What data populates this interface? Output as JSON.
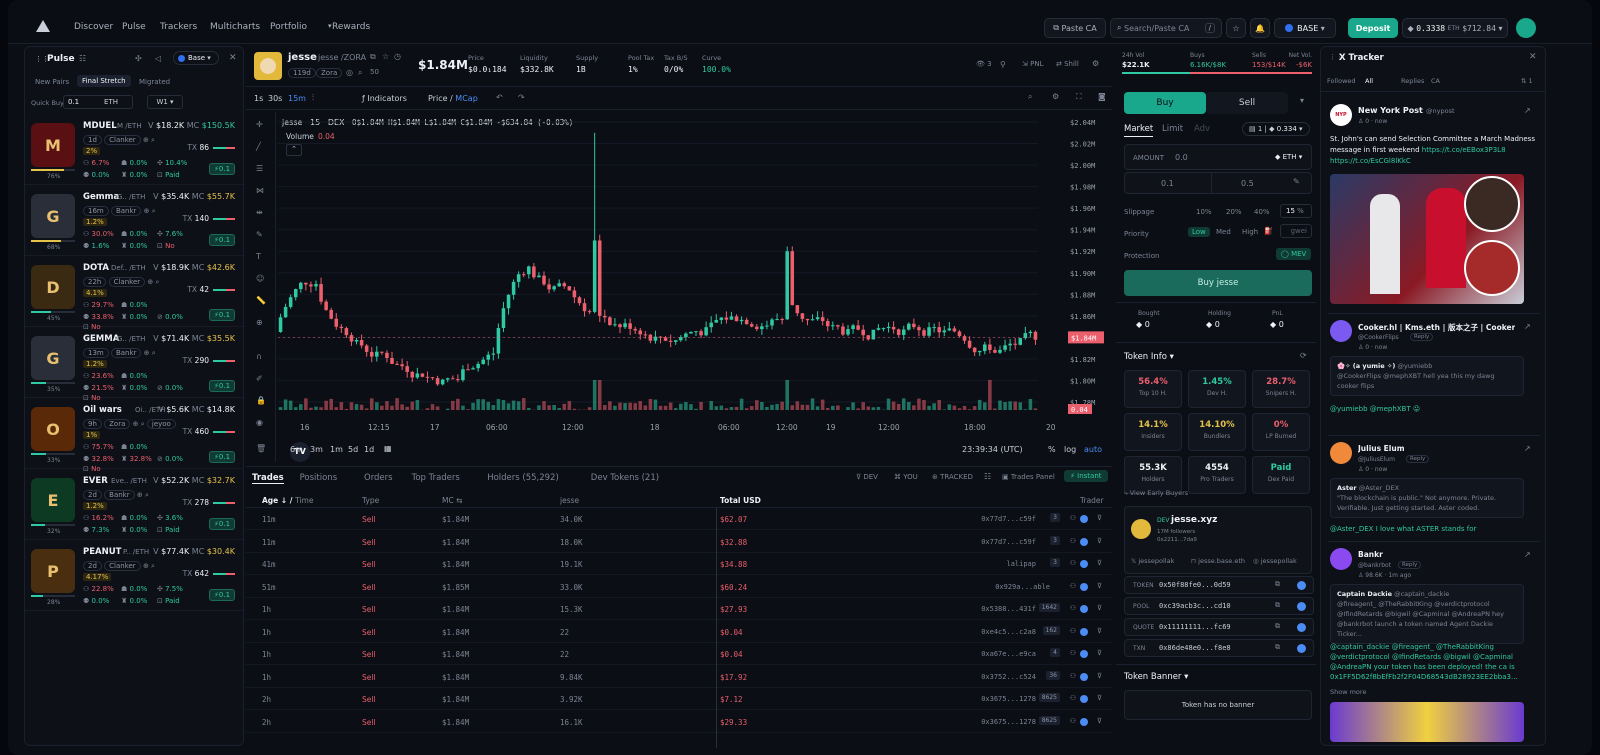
{
  "nav": {
    "items": [
      "Discover",
      "Pulse",
      "Trackers",
      "Multicharts",
      "Portfolio",
      "Rewards"
    ],
    "paste_ca": "Paste CA",
    "search_placeholder": "Search/Paste CA",
    "search_key": "/",
    "chain": "BASE",
    "deposit": "Deposit",
    "eth_balance": "0.3338",
    "eth_unit": "ETH",
    "usd_balance": "$712.84"
  },
  "pulse": {
    "title": "Pulse",
    "chain": "Base",
    "tabs": [
      "New Pairs",
      "Final Stretch",
      "Migrated"
    ],
    "quick_buy_label": "Quick Buy",
    "quick_buy_value": "0.1",
    "quick_buy_unit": "ETH",
    "preset": "W1",
    "tokens": [
      {
        "name": "MDUEL",
        "sub": "M",
        "chain": "/ETH",
        "v": "$18.2K",
        "mc": "$150.5K",
        "age": "1d",
        "launch": "Clanker",
        "tx": "86",
        "pct": "2%",
        "s1": "6.7%",
        "s2": "0.0%",
        "s3": "10.4%",
        "s4": "0.0%",
        "s5": "0.0%",
        "paid": "Paid",
        "progress": "76%",
        "qb": "0.1",
        "mccolor": "#2fc9a3",
        "bg": "#5a0f12",
        "initial": "M"
      },
      {
        "name": "Gemma",
        "sub": "G..",
        "chain": "/ETH",
        "v": "$35.4K",
        "mc": "$55.7K",
        "age": "16m",
        "launch": "Bankr",
        "tx": "140",
        "pct": "1.2%",
        "s1": "30.0%",
        "s2": "0.0%",
        "s3": "7.6%",
        "s4": "1.6%",
        "s5": "0.0%",
        "paid": "No",
        "progress": "68%",
        "qb": "0.1",
        "mccolor": "#e6c24a",
        "bg": "#2a2e38",
        "initial": "G"
      },
      {
        "name": "DOTA",
        "sub": "Def..",
        "chain": "/ETH",
        "v": "$18.9K",
        "mc": "$42.6K",
        "age": "22h",
        "launch": "Clanker",
        "tx": "42",
        "pct": "4.1%",
        "s1": "29.7%",
        "s2": "0.0%",
        "s3": "",
        "s4": "33.8%",
        "s5": "0.0%",
        "s6": "0.0%",
        "paid": "No",
        "progress": "45%",
        "qb": "0.1",
        "mccolor": "#e6c24a",
        "bg": "#3a2a12",
        "initial": "D"
      },
      {
        "name": "GEMMA",
        "sub": "G..",
        "chain": "/ETH",
        "v": "$71.4K",
        "mc": "$35.5K",
        "age": "13m",
        "launch": "Bankr",
        "tx": "290",
        "pct": "1.2%",
        "s1": "23.6%",
        "s2": "0.0%",
        "s3": "",
        "s4": "21.5%",
        "s5": "0.0%",
        "s6": "0.0%",
        "paid": "No",
        "progress": "35%",
        "qb": "0.1",
        "mccolor": "#e6c24a",
        "bg": "#2a2e38",
        "initial": "G"
      },
      {
        "name": "Oil wars",
        "sub": "Oi..",
        "chain": "/ETH",
        "v": "$5.6K",
        "mc": "$14.8K",
        "age": "9h",
        "launch": "Zora",
        "tx": "460",
        "pct": "1%",
        "s1": "75.7%",
        "s2": "0.0%",
        "s3": "",
        "s4": "32.8%",
        "s5": "32.8%",
        "s6": "0.0%",
        "paid": "No",
        "progress": "33%",
        "qb": "0.1",
        "mccolor": "#eef1f6",
        "bg": "#5a2a08",
        "initial": "O",
        "extra": "jeyoo"
      },
      {
        "name": "EVER",
        "sub": "Eve..",
        "chain": "/ETH",
        "v": "$52.2K",
        "mc": "$32.7K",
        "age": "2d",
        "launch": "Bankr",
        "tx": "278",
        "pct": "1.2%",
        "s1": "16.2%",
        "s2": "0.0%",
        "s3": "3.6%",
        "s4": "7.3%",
        "s5": "0.0%",
        "paid": "Paid",
        "progress": "32%",
        "qb": "0.1",
        "mccolor": "#e6c24a",
        "bg": "#0c3a22",
        "initial": "E"
      },
      {
        "name": "PEANUT",
        "sub": "P..",
        "chain": "/ETH",
        "v": "$77.4K",
        "mc": "$30.4K",
        "age": "2d",
        "launch": "Clanker",
        "tx": "642",
        "pct": "4.17%",
        "s1": "22.8%",
        "s2": "0.0%",
        "s3": "7.5%",
        "s4": "0.0%",
        "s5": "0.0%",
        "paid": "Paid",
        "progress": "28%",
        "qb": "0.1",
        "mccolor": "#e6c24a",
        "bg": "#4a2e10",
        "initial": "P"
      }
    ]
  },
  "token": {
    "name": "jesse",
    "pair": "jesse /ZORA",
    "age": "119d",
    "launch": "Zora",
    "holders_small": "50",
    "price_mc": "$1.84M",
    "stats": [
      {
        "label": "Price",
        "value": "$0.0₁184"
      },
      {
        "label": "Liquidity",
        "value": "$332.8K"
      },
      {
        "label": "Supply",
        "value": "1B"
      },
      {
        "label": "Pool Tax",
        "value": "1%"
      },
      {
        "label": "Tax B/S",
        "value": "0/0%"
      },
      {
        "label": "Curve",
        "value": "100.0%"
      }
    ],
    "watchers": "3",
    "pnl": "PNL",
    "shill": "Shill"
  },
  "chart": {
    "intervals": [
      "1s",
      "30s",
      "15m"
    ],
    "indicators": "Indicators",
    "price_mode": "Price",
    "mcap_mode": "MCap",
    "legend": "jesse · 15 · DEX",
    "ohlc": "O$1.84M H$1.84M L$1.84M C$1.84M -$634.84 (-0.03%)",
    "volume_label": "Volume",
    "volume_value": "0.04",
    "yticks": [
      "$2.04M",
      "$2.02M",
      "$2.00M",
      "$1.98M",
      "$1.96M",
      "$1.94M",
      "$1.92M",
      "$1.90M",
      "$1.88M",
      "$1.86M",
      "$1.84M",
      "$1.82M",
      "$1.80M",
      "$1.78M"
    ],
    "last_price": "$1.84M",
    "vol_tag": "0.04",
    "xticks": [
      "16",
      "12:15",
      "17",
      "06:00",
      "12:00",
      "18",
      "06:00",
      "12:00",
      "19",
      "12:00",
      "18:00",
      "20"
    ],
    "ranges": [
      "6m",
      "3m",
      "1m",
      "5d",
      "1d"
    ],
    "time": "23:39:34 (UTC)",
    "scale": [
      "%",
      "log",
      "auto"
    ]
  },
  "trades": {
    "tabs": [
      "Trades",
      "Positions",
      "Orders",
      "Top Traders",
      "Holders (55,292)",
      "Dev Tokens (21)"
    ],
    "filters": [
      "DEV",
      "YOU",
      "TRACKED"
    ],
    "panel": "Trades Panel",
    "instant": "Instant",
    "headers": [
      "Age",
      "Time",
      "Type",
      "MC",
      "jesse",
      "Total USD",
      "Trader"
    ],
    "rows": [
      [
        "11m",
        "Sell",
        "$1.84M",
        "34.0K",
        "$62.07",
        "0x77d7...c59f",
        "3"
      ],
      [
        "11m",
        "Sell",
        "$1.84M",
        "18.0K",
        "$32.88",
        "0x77d7...c59f",
        "3"
      ],
      [
        "41m",
        "Sell",
        "$1.84M",
        "19.1K",
        "$34.88",
        "lalipap",
        "3"
      ],
      [
        "51m",
        "Sell",
        "$1.85M",
        "33.0K",
        "$60.24",
        "0x929a...able",
        ""
      ],
      [
        "1h",
        "Sell",
        "$1.84M",
        "15.3K",
        "$27.93",
        "0x5388...431f",
        "1642"
      ],
      [
        "1h",
        "Sell",
        "$1.84M",
        "22",
        "$0.04",
        "0xe4c5...c2a8",
        "162"
      ],
      [
        "1h",
        "Sell",
        "$1.84M",
        "22",
        "$0.04",
        "0xa67e...e9ca",
        "4"
      ],
      [
        "1h",
        "Sell",
        "$1.84M",
        "9.84K",
        "$17.92",
        "0x3752...c524",
        "36"
      ],
      [
        "2h",
        "Sell",
        "$1.84M",
        "3.92K",
        "$7.12",
        "0x3675...1278",
        "8625"
      ],
      [
        "2h",
        "Sell",
        "$1.84M",
        "16.1K",
        "$29.33",
        "0x3675...1278",
        "8625"
      ]
    ]
  },
  "order": {
    "stats": [
      {
        "label": "24h Vol",
        "value": "$22.1K"
      },
      {
        "label": "Buys",
        "value": "6.16K/$8K"
      },
      {
        "label": "Sells",
        "value": "153/$14K"
      },
      {
        "label": "Net Vol.",
        "value": "-$6K"
      }
    ],
    "buy": "Buy",
    "sell": "Sell",
    "types": [
      "Market",
      "Limit",
      "Adv"
    ],
    "wallet_count": "1",
    "wallet_bal": "0.334",
    "amount_label": "AMOUNT",
    "amount_value": "0.0",
    "amount_unit": "ETH",
    "presets": [
      "0.1",
      "0.5"
    ],
    "slippage_label": "Slippage",
    "slippage_opts": [
      "10%",
      "20%",
      "40%"
    ],
    "slippage_custom": "15",
    "slippage_unit": "%",
    "priority_label": "Priority",
    "priority_opts": [
      "Low",
      "Med",
      "High"
    ],
    "gwei": "gwei",
    "protection_label": "Protection",
    "mev": "MEV",
    "buy_button": "Buy jesse",
    "position": [
      {
        "label": "Bought",
        "value": "0"
      },
      {
        "label": "Holding",
        "value": "0"
      },
      {
        "label": "PnL",
        "value": "0"
      }
    ],
    "token_info_title": "Token Info",
    "info": [
      {
        "v": "56.4%",
        "l": "Top 10 H.",
        "c": "red"
      },
      {
        "v": "1.45%",
        "l": "Dev H.",
        "c": "green"
      },
      {
        "v": "28.7%",
        "l": "Snipers H.",
        "c": "red"
      },
      {
        "v": "14.1%",
        "l": "Insiders",
        "c": "yellow"
      },
      {
        "v": "14.10%",
        "l": "Bundlers",
        "c": "yellow"
      },
      {
        "v": "0%",
        "l": "LP Burned",
        "c": "red"
      },
      {
        "v": "55.3K",
        "l": "Holders",
        "c": "white"
      },
      {
        "v": "4554",
        "l": "Pro Traders",
        "c": "white"
      },
      {
        "v": "Paid",
        "l": "Dex Paid",
        "c": "green"
      }
    ],
    "early_buyers": "View Early Buyers",
    "dev": {
      "tag": "DEV",
      "name": "jesse.xyz",
      "followers": "17M followers",
      "addr": "0x2211...7da9",
      "links": [
        "jessepollak",
        "jesse.base.eth",
        "jessepollak"
      ]
    },
    "addresses": [
      {
        "label": "TOKEN",
        "value": "0x50f88fe0...0d59"
      },
      {
        "label": "POOL",
        "value": "0xc39acb3c...cd10"
      },
      {
        "label": "QUOTE",
        "value": "0x11111111...fc69"
      },
      {
        "label": "TXN",
        "value": "0x86de48e0...f8e8"
      }
    ],
    "banner_title": "Token Banner",
    "banner_empty": "Token has no banner"
  },
  "xtracker": {
    "title": "X Tracker",
    "tabs": [
      "Followed",
      "All",
      "Replies",
      "CA"
    ],
    "count": "1",
    "posts": [
      {
        "name": "New York Post",
        "handle": "@nypost",
        "meta_count": "0",
        "time": "now",
        "text": "St. John's can send Selection Committee a March Madness message in first weekend",
        "link": "https://t.co/eEBox3P3L8 https://t.co/EsCGl8lKkC"
      },
      {
        "name": "Cooker.hl | Kms.eth | 版本之子 | Cooker",
        "handle": "@CookerFlips",
        "badge": "Reply",
        "meta_count": "0",
        "time": "now",
        "quote_name": "🌸✧ (a yumie ✧)",
        "quote_handle": "@yumiebb",
        "quote_text": "@CookerFlips @mephXBT hell yea this my dawg cooker flips",
        "text": "@yumiebb @mephXBT 😛"
      },
      {
        "name": "Julius Elum",
        "handle": "@JuliusElum",
        "badge": "Reply",
        "meta_count": "0",
        "time": "now",
        "quote_name": "Aster",
        "quote_handle": "@Aster_DEX",
        "quote_text": "\"The blockchain is public.\" Not anymore. Private. Verifiable. Just getting started. Aster coded.",
        "text": "@Aster_DEX I love what ASTER stands for"
      },
      {
        "name": "Bankr",
        "handle": "@bankrbot",
        "badge": "Reply",
        "meta_count": "98.6K",
        "time": "1m ago",
        "quote_name": "Captain Dackie",
        "quote_handle": "@captain_dackie",
        "quote_text": "@fireagent_ @TheRabbitKing @verdictprotocol @IfindRetards @bigwil @Capminal @AndreaPN hey @bankrbot launch a token named Agent Dackie Ticker...",
        "text": "@captain_dackie @fireagent_ @TheRabbitKing @verdictprotocol @IfindRetards @bigwil @Capminal @AndreaPN your token has been deployed! the ca is 0x1FF5D62f8bEfFb2f2F04D68543dB28923EE2bba3...",
        "more": "Show more"
      }
    ]
  },
  "colors": {
    "green": "#2fc9a3",
    "red": "#ec5f6d",
    "yellow": "#e6c24a",
    "accent": "#19a88b"
  }
}
